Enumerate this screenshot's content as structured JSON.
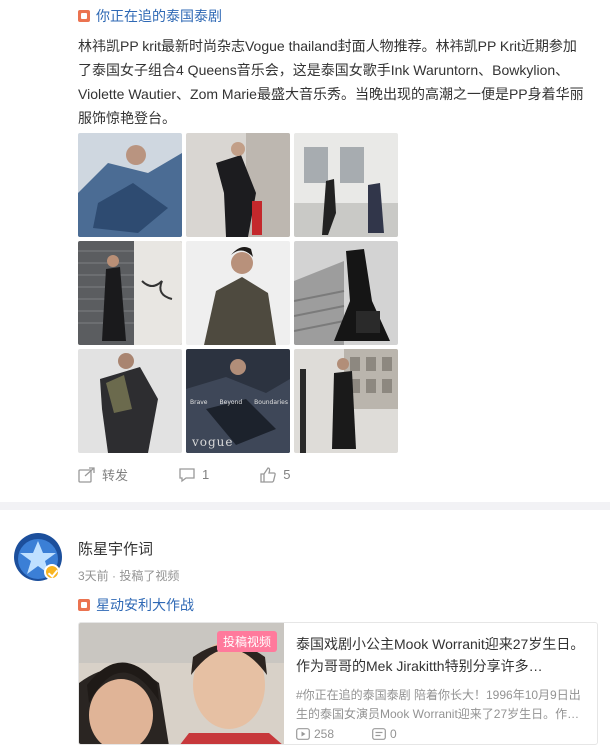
{
  "post1": {
    "topic": "你正在追的泰国泰剧",
    "text": "林祎凯PP krit最新时尚杂志Vogue thailand封面人物推荐。林祎凯PP Krit近期参加了泰国女子组合4 Queens音乐会，这是泰国女歌手Ink Waruntorn、Bowkylion、Violette Wautier、Zom Marie最盛大音乐秀。当晚出现的高潮之一便是PP身着华丽服饰惊艳登台。",
    "photo_caption_words": [
      "Brave",
      "Beyond",
      "Boundaries"
    ],
    "photo_logo": "vogue",
    "actions": {
      "repost": "转发",
      "comments": "1",
      "likes": "5"
    }
  },
  "post2": {
    "author": "陈星宇作词",
    "meta": "3天前 · 投稿了视频",
    "topic": "星动安利大作战",
    "video": {
      "tag": "投稿视频",
      "title": "泰国戏剧小公主Mook Worranit迎来27岁生日。作为哥哥的Mek Jirakitth特别分享许多…",
      "desc": "#你正在追的泰国泰剧 陪着你长大！1996年10月9日出生的泰国女演员Mook Worranit迎来了27岁生日。作…",
      "plays": "258",
      "comments": "0"
    }
  },
  "colors": {
    "link": "#2f69b5",
    "topic_icon": "#eb7350",
    "tag": "#ff7a9c",
    "badge": "#f8b420"
  }
}
